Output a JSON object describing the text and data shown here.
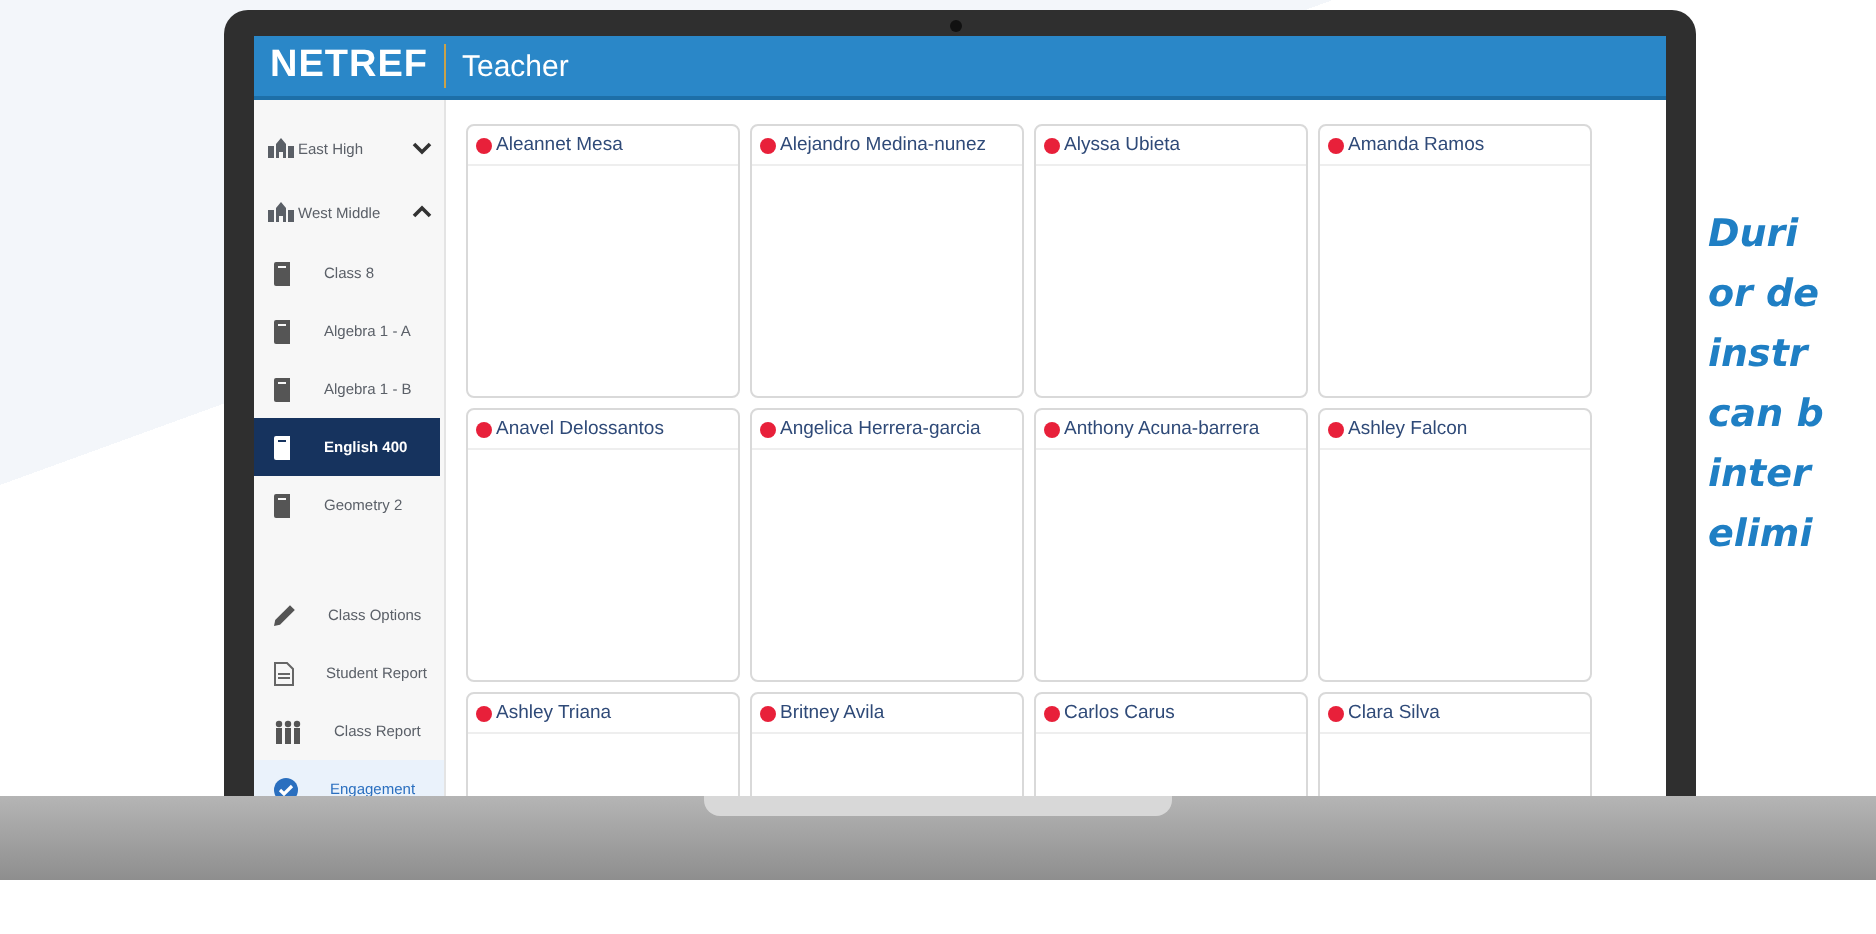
{
  "app": {
    "logo": "NETREF",
    "title": "Teacher"
  },
  "sidebar": {
    "schools": [
      {
        "name": "East High",
        "expanded": false
      },
      {
        "name": "West Middle",
        "expanded": true,
        "classes": [
          {
            "name": "Class 8",
            "selected": false
          },
          {
            "name": "Algebra 1 - A",
            "selected": false
          },
          {
            "name": "Algebra 1 - B",
            "selected": false
          },
          {
            "name": "English 400",
            "selected": true
          },
          {
            "name": "Geometry 2",
            "selected": false
          }
        ]
      }
    ],
    "actions": [
      {
        "kind": "options",
        "label": "Class Options",
        "selected": false
      },
      {
        "kind": "student-report",
        "label": "Student Report",
        "selected": false
      },
      {
        "kind": "class-report",
        "label": "Class Report",
        "selected": false
      },
      {
        "kind": "engagement",
        "label": "Engagement",
        "selected": true
      }
    ]
  },
  "students": [
    {
      "name": "Aleannet Mesa",
      "color": "#e8203a"
    },
    {
      "name": "Alejandro Medina-nunez",
      "color": "#e8203a"
    },
    {
      "name": "Alyssa Ubieta",
      "color": "#e8203a"
    },
    {
      "name": "Amanda Ramos",
      "color": "#e8203a"
    },
    {
      "name": "Anavel Delossantos",
      "color": "#e8203a"
    },
    {
      "name": "Angelica Herrera-garcia",
      "color": "#e8203a"
    },
    {
      "name": "Anthony Acuna-barrera",
      "color": "#e8203a"
    },
    {
      "name": "Ashley Falcon",
      "color": "#e8203a"
    },
    {
      "name": "Ashley Triana",
      "color": "#e8203a"
    },
    {
      "name": "Britney Avila",
      "color": "#e8203a"
    },
    {
      "name": "Carlos Carus",
      "color": "#e8203a"
    },
    {
      "name": "Clara Silva",
      "color": "#e8203a"
    }
  ],
  "blurb": [
    "Duri",
    "or de",
    "instr",
    "can b",
    "inter",
    "elimi"
  ]
}
